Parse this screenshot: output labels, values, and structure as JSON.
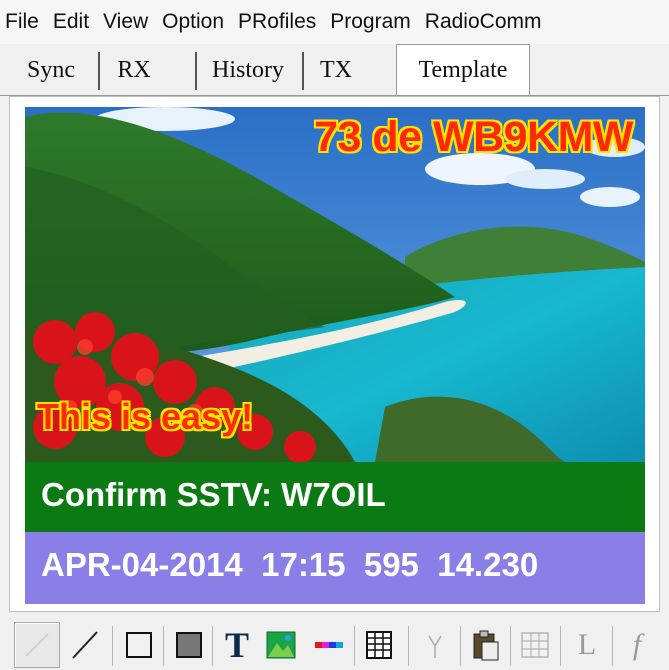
{
  "menu": {
    "items": [
      "File",
      "Edit",
      "View",
      "Option",
      "PRofiles",
      "Program",
      "RadioComm"
    ]
  },
  "tabs": {
    "items": [
      "Sync",
      "RX",
      "History",
      "TX",
      "Template"
    ],
    "active": "Template"
  },
  "template": {
    "callsign_text": "73 de WB9KMW",
    "caption_text": "This is easy!",
    "confirm_text": "Confirm SSTV: W7OIL",
    "info_text": "APR-04-2014  17:15  595  14.230",
    "colors": {
      "text_fill": "#ff2a00",
      "text_outline": "#ffe400",
      "confirm_bar": "#0c7a12",
      "info_bar": "#8a7fe6"
    }
  },
  "toolbar": {
    "tools": [
      "select-icon",
      "line-icon",
      "rectangle-icon",
      "filled-rectangle-icon",
      "text-icon",
      "image-icon",
      "color-bar-icon",
      "grid-icon",
      "antenna-icon",
      "paste-icon",
      "table-icon",
      "L",
      "f"
    ],
    "text_tool_label": "T",
    "list_tool_label": "L",
    "function_tool_label": "f"
  }
}
